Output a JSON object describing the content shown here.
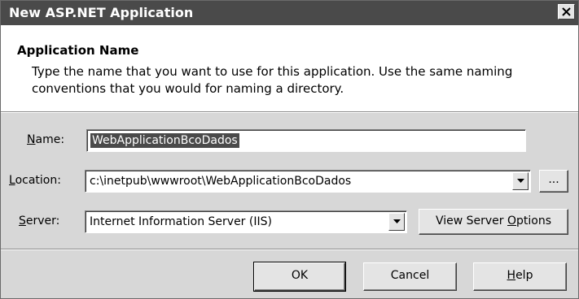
{
  "window": {
    "title": "New ASP.NET Application",
    "close_icon": "close-icon"
  },
  "header": {
    "title": "Application Name",
    "description": "Type the name that you want to use for this application.  Use the same naming conventions that you would for naming a directory."
  },
  "form": {
    "name": {
      "label_mnemonic": "N",
      "label_rest": "ame:",
      "value": "WebApplicationBcoDados"
    },
    "location": {
      "label_mnemonic": "L",
      "label_rest": "ocation:",
      "value": "c:\\inetpub\\wwwroot\\WebApplicationBcoDados",
      "browse_label": "..."
    },
    "server": {
      "label_mnemonic": "S",
      "label_rest": "erver:",
      "value": "Internet Information Server (IIS)",
      "view_options_prefix": "View Server ",
      "view_options_mnemonic": "O",
      "view_options_rest": "ptions"
    }
  },
  "buttons": {
    "ok": "OK",
    "cancel": "Cancel",
    "help_mnemonic": "H",
    "help_rest": "elp"
  },
  "colors": {
    "titlebar": "#4a4a4a",
    "dialog_face": "#d7d7d7",
    "header_panel": "#ffffff",
    "selection": "#4a4a4a"
  }
}
